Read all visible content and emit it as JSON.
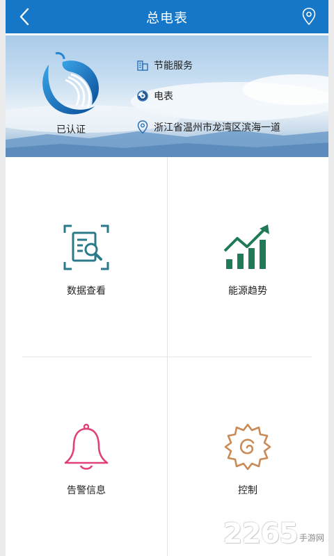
{
  "header": {
    "title": "总电表",
    "back_icon": "chevron-left-icon",
    "location_icon": "location-pin-icon"
  },
  "banner": {
    "certified_label": "已认证",
    "service_label": "节能服务",
    "meter_label": "电表",
    "address": "浙江省温州市龙湾区滨海一道"
  },
  "tiles": [
    {
      "label": "数据查看",
      "icon": "data-view-icon",
      "color": "#2b7a8c"
    },
    {
      "label": "能源趋势",
      "icon": "energy-trend-icon",
      "color": "#1f7a55"
    },
    {
      "label": "告警信息",
      "icon": "alarm-bell-icon",
      "color": "#e0417a"
    },
    {
      "label": "控制",
      "icon": "control-gear-icon",
      "color": "#c98a55"
    }
  ],
  "watermark": {
    "number": "2265",
    "text": "手游网"
  },
  "colors": {
    "header": "#1677c9",
    "accent_blue": "#1677c9"
  }
}
